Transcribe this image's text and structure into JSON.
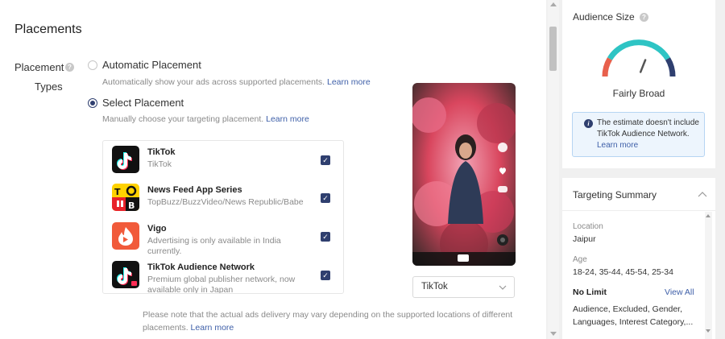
{
  "placements": {
    "title": "Placements",
    "types_label_line1": "Placement",
    "types_label_line2": "Types",
    "automatic": {
      "label": "Automatic Placement",
      "description": "Automatically show your ads across supported placements.",
      "link": "Learn more",
      "selected": false
    },
    "select": {
      "label": "Select Placement",
      "description": "Manually choose your targeting placement.",
      "link": "Learn more",
      "selected": true
    },
    "items": [
      {
        "name": "TikTok",
        "description": "TikTok",
        "checked": true,
        "icon": "tiktok-logo"
      },
      {
        "name": "News Feed App Series",
        "description": "TopBuzz/BuzzVideo/News Republic/Babe",
        "checked": true,
        "icon": "news-feed-logo"
      },
      {
        "name": "Vigo",
        "description": "Advertising is only available in India currently.",
        "checked": true,
        "icon": "vigo-logo"
      },
      {
        "name": "TikTok Audience Network",
        "description": "Premium global publisher network, now available only in Japan",
        "checked": true,
        "icon": "tiktok-audience-network-logo"
      }
    ],
    "note": "Please note that the actual ads delivery may vary depending on the supported locations of different placements.",
    "note_link": "Learn more",
    "preview_select_value": "TikTok"
  },
  "audience_size": {
    "title": "Audience Size",
    "gauge_level": 0.62,
    "breadth": "Fairly Broad",
    "info": "The estimate doesn't include TikTok Audience Network.",
    "info_link": "Learn more",
    "colors": {
      "low": "#e8604c",
      "mid": "#2ec4c4",
      "high": "#2f3f6f"
    }
  },
  "targeting_summary": {
    "title": "Targeting Summary",
    "location_label": "Location",
    "location_value": "Jaipur",
    "age_label": "Age",
    "age_value": "18-24, 35-44, 45-54, 25-34",
    "no_limit_label": "No Limit",
    "view_all": "View All",
    "no_limit_value": "Audience, Excluded, Gender, Languages, Interest Category,..."
  }
}
